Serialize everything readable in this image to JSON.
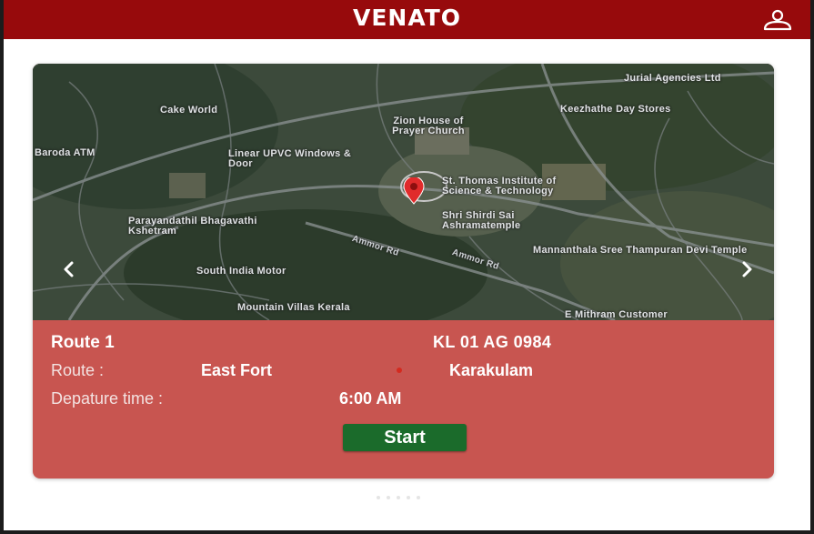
{
  "header": {
    "title": "VENATO",
    "profile_icon": "user-icon"
  },
  "map_labels": [
    "Jurial Agencies Ltd",
    "Cake World",
    "Zion House of Prayer Church",
    "Keezhathe Day Stores",
    "Baroda ATM",
    "Linear UPVC Windows & Door",
    "St. Thomas Institute of Science & Technology",
    "Shri Shirdi Sai Ashramatemple",
    "Parayandathil Bhagavathi Kshetram",
    "South India Motor",
    "Ammor Rd",
    "Ammor Rd",
    "Mannanthala Sree Thampuran Devi Temple",
    "Mountain Villas Kerala",
    "E Mithram Customer"
  ],
  "carousel": {
    "prev_icon": "chevron-left-icon",
    "next_icon": "chevron-right-icon",
    "page_count": 5
  },
  "route": {
    "name": "Route 1",
    "vehicle_number": "KL 01 AG 0984",
    "route_label": "Route :",
    "from": "East Fort",
    "to": "Karakulam",
    "departure_label": "Depature time :",
    "departure_time": "6:00 AM",
    "start_label": "Start"
  },
  "colors": {
    "header": "#970a0c",
    "card": "#c85550",
    "start_button": "#1b6b2b",
    "pin": "#e02b2b"
  }
}
